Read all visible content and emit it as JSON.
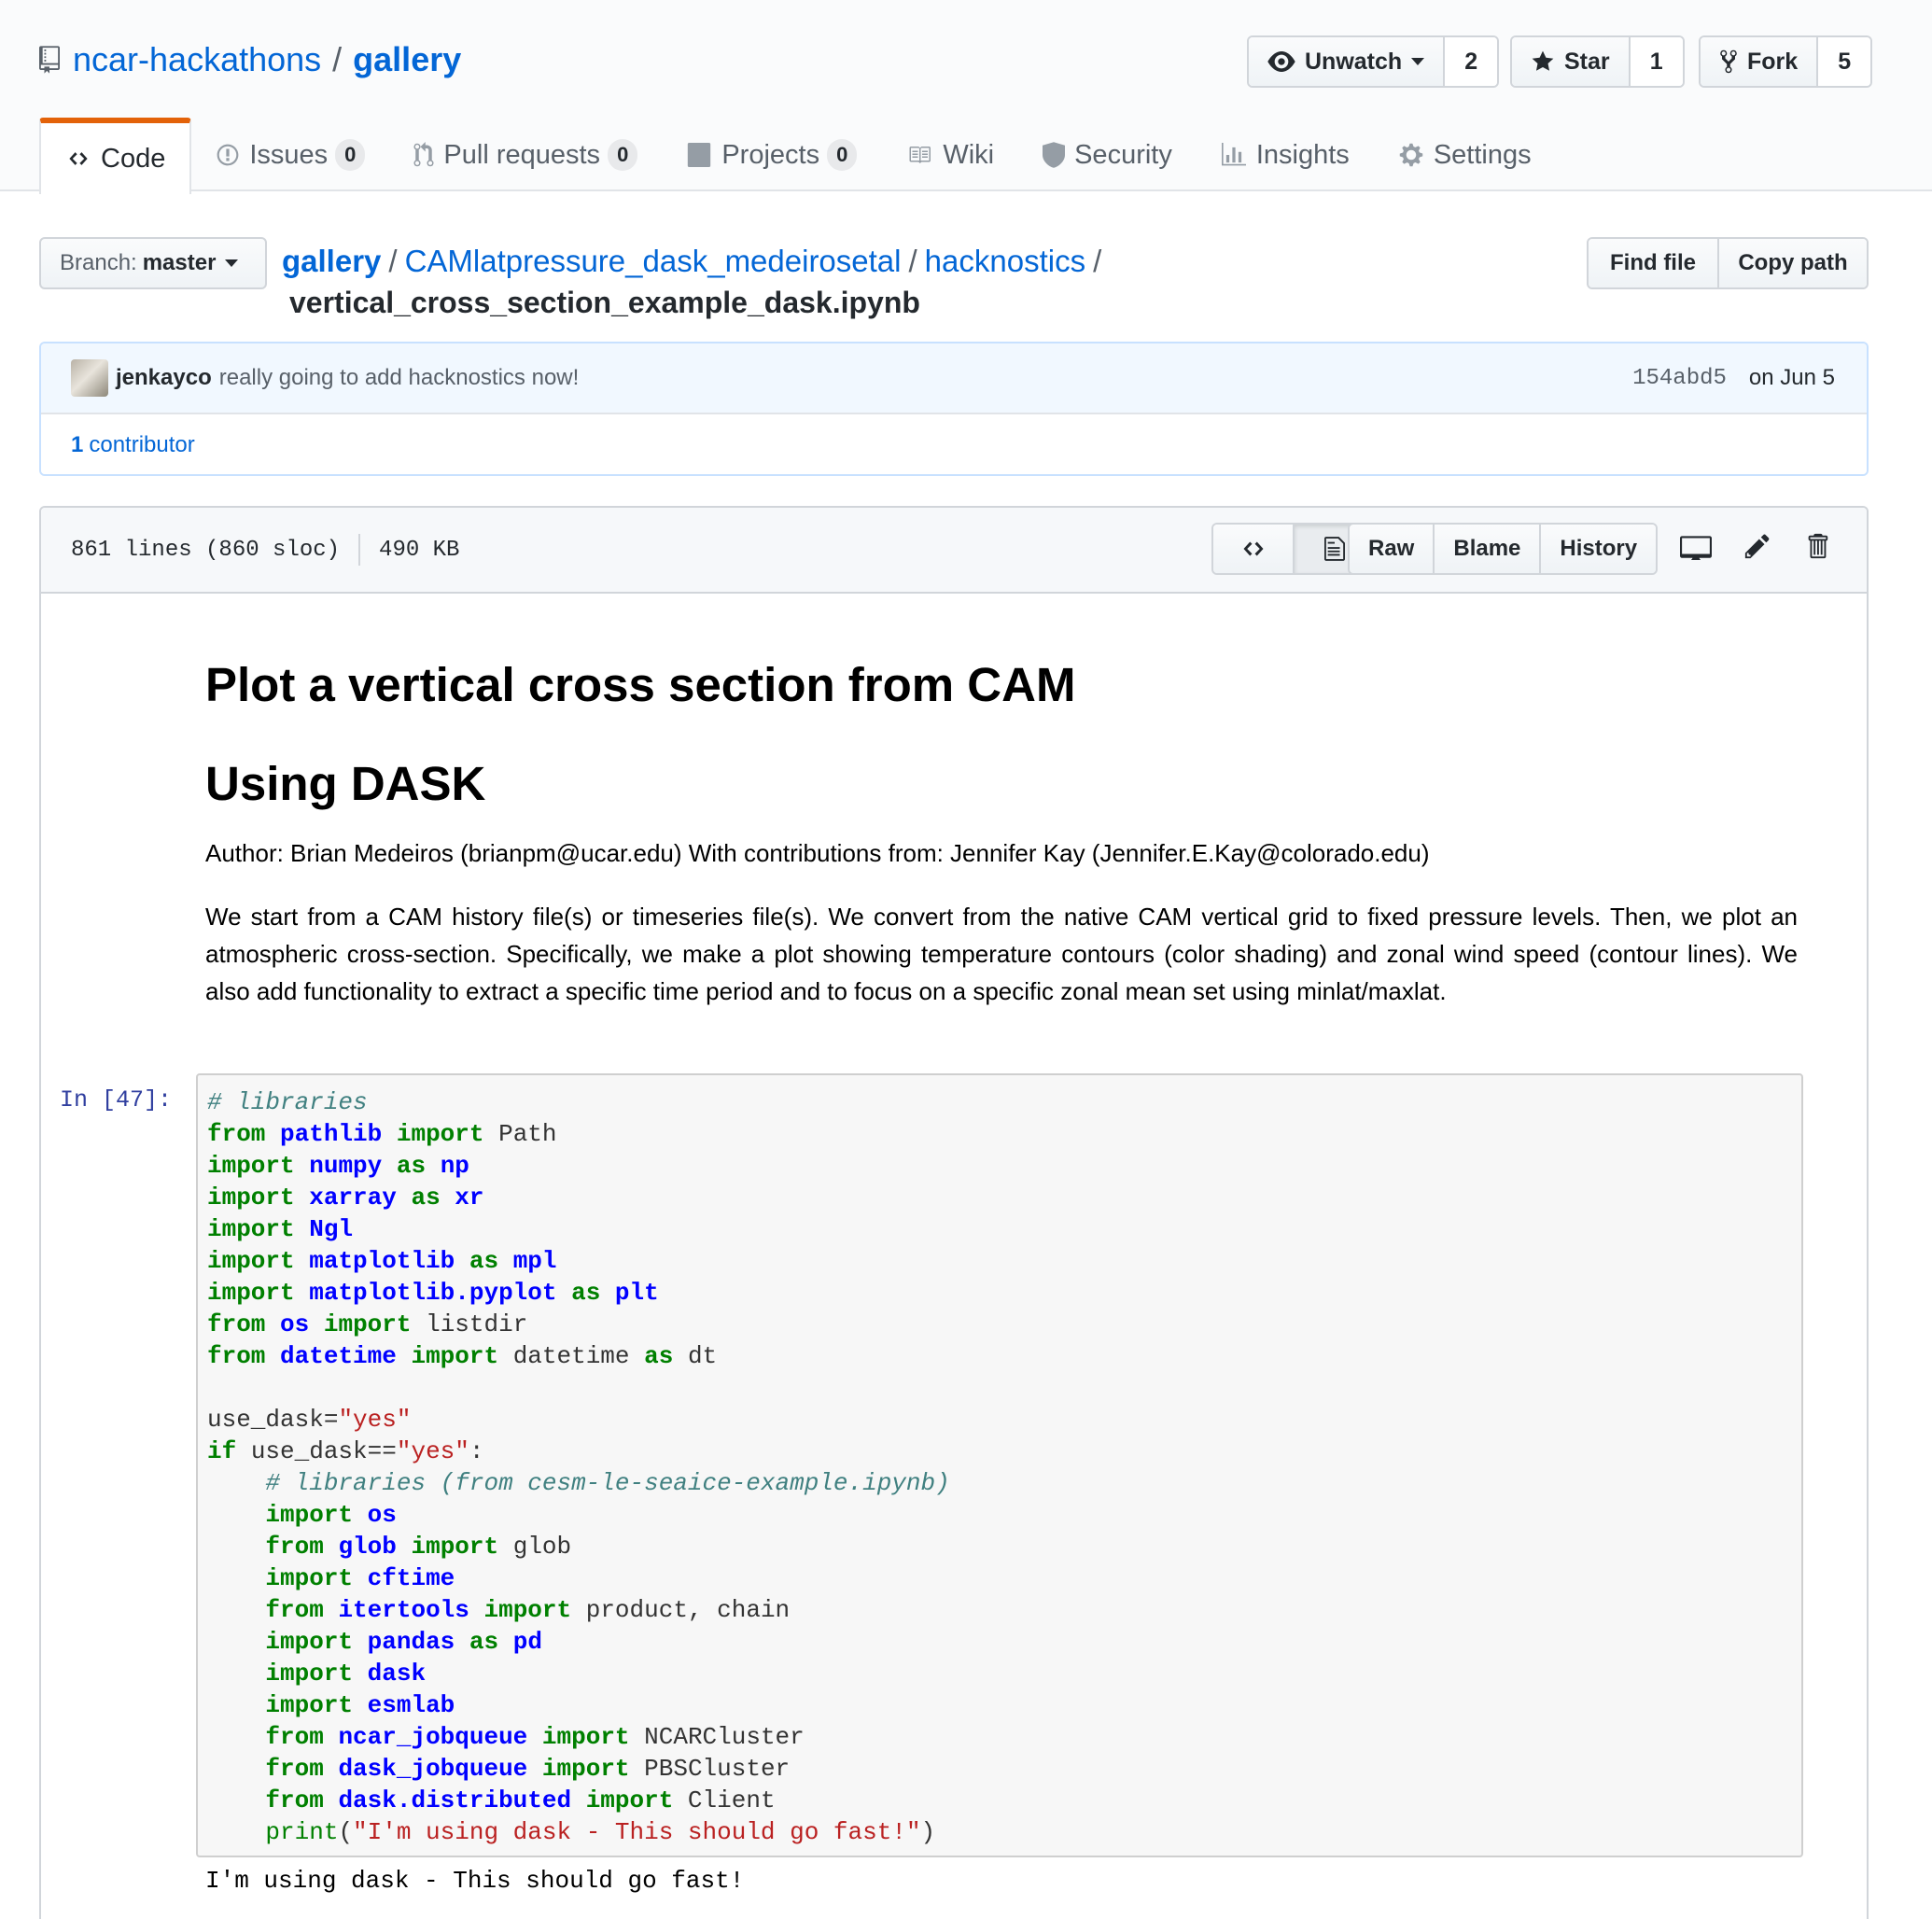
{
  "repo": {
    "owner": "ncar-hackathons",
    "separator": "/",
    "name": "gallery"
  },
  "actions": {
    "watch": {
      "label": "Unwatch",
      "count": "2"
    },
    "star": {
      "label": "Star",
      "count": "1"
    },
    "fork": {
      "label": "Fork",
      "count": "5"
    }
  },
  "tabs": [
    {
      "label": "Code",
      "icon": "code-icon",
      "selected": true
    },
    {
      "label": "Issues",
      "icon": "issue-icon",
      "count": "0"
    },
    {
      "label": "Pull requests",
      "icon": "pull-request-icon",
      "count": "0"
    },
    {
      "label": "Projects",
      "icon": "project-icon",
      "count": "0"
    },
    {
      "label": "Wiki",
      "icon": "book-icon"
    },
    {
      "label": "Security",
      "icon": "shield-icon"
    },
    {
      "label": "Insights",
      "icon": "graph-icon"
    },
    {
      "label": "Settings",
      "icon": "gear-icon"
    }
  ],
  "branch": {
    "prefix": "Branch:",
    "name": "master"
  },
  "breadcrumb": {
    "items": [
      "gallery",
      "CAMlatpressure_dask_medeirosetal",
      "hacknostics"
    ],
    "separator": "/",
    "file": "vertical_cross_section_example_dask.ipynb"
  },
  "path_buttons": {
    "find": "Find file",
    "copy": "Copy path"
  },
  "commit": {
    "author": "jenkayco",
    "message": "really going to add hacknostics now!",
    "sha": "154abd5",
    "date": "on Jun 5"
  },
  "contributors": {
    "count": "1",
    "label": "contributor"
  },
  "file_info": {
    "lines": "861 lines (860 sloc)",
    "size": "490 KB"
  },
  "file_actions": {
    "raw": "Raw",
    "blame": "Blame",
    "history": "History"
  },
  "notebook": {
    "title": "Plot a vertical cross section from CAM",
    "subtitle": "Using DASK",
    "author": "Author: Brian Medeiros (brianpm@ucar.edu) With contributions from: Jennifer Kay (Jennifer.E.Kay@colorado.edu)",
    "description": "We start from a CAM history file(s) or timeseries file(s). We convert from the native CAM vertical grid to fixed pressure levels. Then, we plot an atmospheric cross-section. Specifically, we make a plot showing temperature contours (color shading) and zonal wind speed (contour lines). We also add functionality to extract a specific time period and to focus on a specific zonal mean set using minlat/maxlat.",
    "prompt": "In [47]:",
    "code_lines": [
      [
        [
          "c",
          "# libraries"
        ]
      ],
      [
        [
          "k",
          "from"
        ],
        [
          "t",
          " "
        ],
        [
          "n",
          "pathlib"
        ],
        [
          "t",
          " "
        ],
        [
          "k",
          "import"
        ],
        [
          "t",
          " Path"
        ]
      ],
      [
        [
          "k",
          "import"
        ],
        [
          "t",
          " "
        ],
        [
          "n",
          "numpy"
        ],
        [
          "t",
          " "
        ],
        [
          "k",
          "as"
        ],
        [
          "t",
          " "
        ],
        [
          "n",
          "np"
        ]
      ],
      [
        [
          "k",
          "import"
        ],
        [
          "t",
          " "
        ],
        [
          "n",
          "xarray"
        ],
        [
          "t",
          " "
        ],
        [
          "k",
          "as"
        ],
        [
          "t",
          " "
        ],
        [
          "n",
          "xr"
        ]
      ],
      [
        [
          "k",
          "import"
        ],
        [
          "t",
          " "
        ],
        [
          "n",
          "Ngl"
        ]
      ],
      [
        [
          "k",
          "import"
        ],
        [
          "t",
          " "
        ],
        [
          "n",
          "matplotlib"
        ],
        [
          "t",
          " "
        ],
        [
          "k",
          "as"
        ],
        [
          "t",
          " "
        ],
        [
          "n",
          "mpl"
        ]
      ],
      [
        [
          "k",
          "import"
        ],
        [
          "t",
          " "
        ],
        [
          "n",
          "matplotlib.pyplot"
        ],
        [
          "t",
          " "
        ],
        [
          "k",
          "as"
        ],
        [
          "t",
          " "
        ],
        [
          "n",
          "plt"
        ]
      ],
      [
        [
          "k",
          "from"
        ],
        [
          "t",
          " "
        ],
        [
          "n",
          "os"
        ],
        [
          "t",
          " "
        ],
        [
          "k",
          "import"
        ],
        [
          "t",
          " listdir"
        ]
      ],
      [
        [
          "k",
          "from"
        ],
        [
          "t",
          " "
        ],
        [
          "n",
          "datetime"
        ],
        [
          "t",
          " "
        ],
        [
          "k",
          "import"
        ],
        [
          "t",
          " datetime "
        ],
        [
          "k",
          "as"
        ],
        [
          "t",
          " dt"
        ]
      ],
      [
        [
          "t",
          ""
        ]
      ],
      [
        [
          "t",
          "use_dask="
        ],
        [
          "s",
          "\"yes\""
        ]
      ],
      [
        [
          "k",
          "if"
        ],
        [
          "t",
          " use_dask=="
        ],
        [
          "s",
          "\"yes\""
        ],
        [
          "t",
          ":"
        ]
      ],
      [
        [
          "t",
          "    "
        ],
        [
          "c",
          "# libraries (from cesm-le-seaice-example.ipynb)"
        ]
      ],
      [
        [
          "t",
          "    "
        ],
        [
          "k",
          "import"
        ],
        [
          "t",
          " "
        ],
        [
          "n",
          "os"
        ]
      ],
      [
        [
          "t",
          "    "
        ],
        [
          "k",
          "from"
        ],
        [
          "t",
          " "
        ],
        [
          "n",
          "glob"
        ],
        [
          "t",
          " "
        ],
        [
          "k",
          "import"
        ],
        [
          "t",
          " glob"
        ]
      ],
      [
        [
          "t",
          "    "
        ],
        [
          "k",
          "import"
        ],
        [
          "t",
          " "
        ],
        [
          "n",
          "cftime"
        ]
      ],
      [
        [
          "t",
          "    "
        ],
        [
          "k",
          "from"
        ],
        [
          "t",
          " "
        ],
        [
          "n",
          "itertools"
        ],
        [
          "t",
          " "
        ],
        [
          "k",
          "import"
        ],
        [
          "t",
          " product, chain"
        ]
      ],
      [
        [
          "t",
          "    "
        ],
        [
          "k",
          "import"
        ],
        [
          "t",
          " "
        ],
        [
          "n",
          "pandas"
        ],
        [
          "t",
          " "
        ],
        [
          "k",
          "as"
        ],
        [
          "t",
          " "
        ],
        [
          "n",
          "pd"
        ]
      ],
      [
        [
          "t",
          "    "
        ],
        [
          "k",
          "import"
        ],
        [
          "t",
          " "
        ],
        [
          "n",
          "dask"
        ]
      ],
      [
        [
          "t",
          "    "
        ],
        [
          "k",
          "import"
        ],
        [
          "t",
          " "
        ],
        [
          "n",
          "esmlab"
        ]
      ],
      [
        [
          "t",
          "    "
        ],
        [
          "k",
          "from"
        ],
        [
          "t",
          " "
        ],
        [
          "n",
          "ncar_jobqueue"
        ],
        [
          "t",
          " "
        ],
        [
          "k",
          "import"
        ],
        [
          "t",
          " NCARCluster"
        ]
      ],
      [
        [
          "t",
          "    "
        ],
        [
          "k",
          "from"
        ],
        [
          "t",
          " "
        ],
        [
          "n",
          "dask_jobqueue"
        ],
        [
          "t",
          " "
        ],
        [
          "k",
          "import"
        ],
        [
          "t",
          " PBSCluster"
        ]
      ],
      [
        [
          "t",
          "    "
        ],
        [
          "k",
          "from"
        ],
        [
          "t",
          " "
        ],
        [
          "n",
          "dask.distributed"
        ],
        [
          "t",
          " "
        ],
        [
          "k",
          "import"
        ],
        [
          "t",
          " Client"
        ]
      ],
      [
        [
          "t",
          "    "
        ],
        [
          "b",
          "print"
        ],
        [
          "t",
          "("
        ],
        [
          "s",
          "\"I'm using dask - This should go fast!\""
        ],
        [
          "t",
          ")"
        ]
      ]
    ],
    "output": "I'm using dask - This should go fast!"
  }
}
